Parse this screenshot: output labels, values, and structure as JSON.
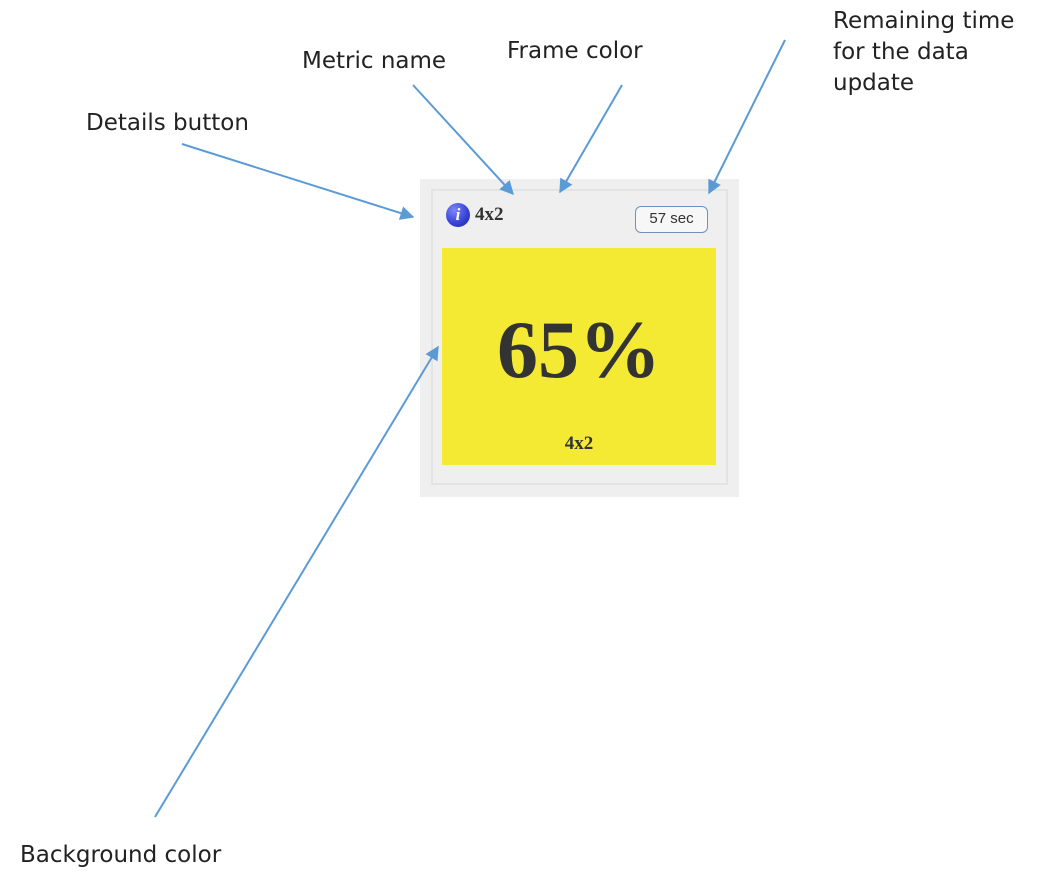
{
  "annotations": {
    "details_button": "Details button",
    "metric_name": "Metric name",
    "frame_color": "Frame color",
    "remaining_time": [
      "Remaining time",
      "for the data",
      "update"
    ],
    "background_color": "Background color"
  },
  "widget": {
    "title": "4x2",
    "timer": "57 sec",
    "value": "65%",
    "caption": "4x2",
    "tile_color": "#f4ea33",
    "frame_color": "#e3e3e3",
    "outer_color": "#efefef",
    "icon": "info-icon"
  },
  "colors": {
    "arrow": "#5b9bd5",
    "icon_blue": "#3a44d6",
    "timer_border": "#6f93b8"
  }
}
